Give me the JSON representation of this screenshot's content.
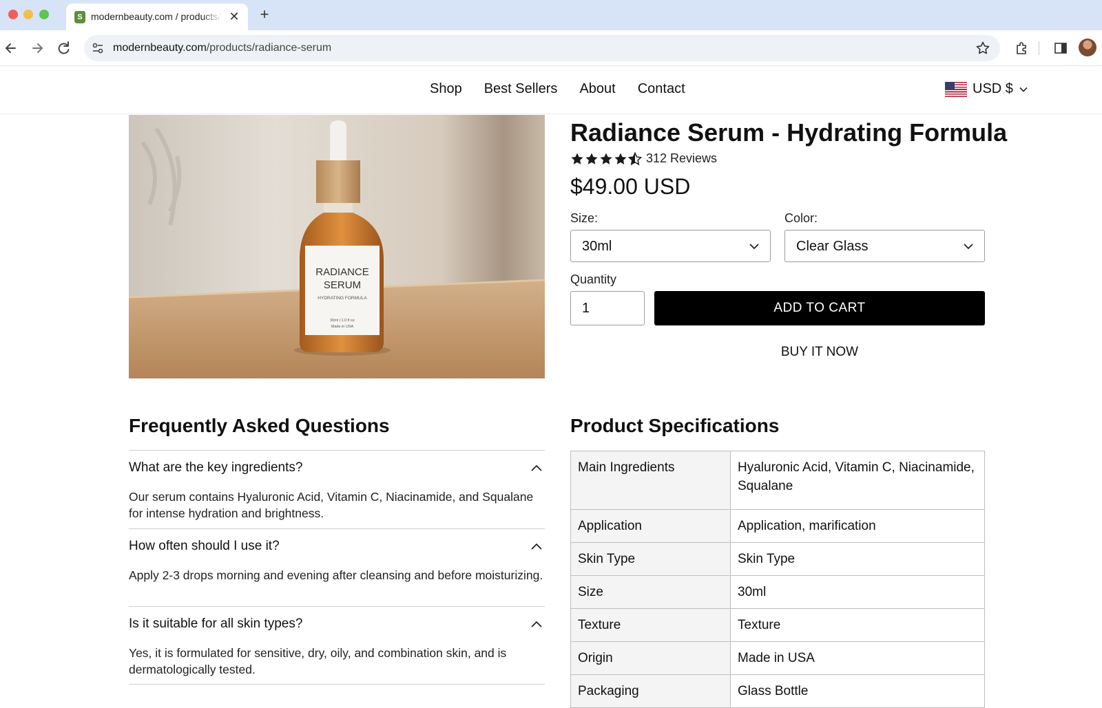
{
  "browser": {
    "tab_title": "modernbeauty.com / products/radiance-serum",
    "tab_close": "✕",
    "new_tab": "+",
    "url_host": "modernbeauty.com",
    "url_path": "/products/radiance-serum",
    "icons": [
      "back-icon",
      "forward-icon",
      "reload-icon",
      "site-settings-icon",
      "bookmark-star-icon",
      "extensions-icon",
      "side-panel-icon",
      "profile-avatar"
    ]
  },
  "nav": {
    "items": [
      "Shop",
      "Best Sellers",
      "About",
      "Contact"
    ],
    "currency": "USD $"
  },
  "product": {
    "title": "Radiance Serum - Hydrating Formula",
    "rating": 4.5,
    "reviews": "312 Reviews",
    "price": "$49.00 USD",
    "size_label": "Size:",
    "size_value": "30ml",
    "color_label": "Color:",
    "color_value": "Clear Glass",
    "quantity_label": "Quantity",
    "quantity_value": "1",
    "add_to_cart": "ADD TO CART",
    "buy_now": "BUY IT NOW",
    "image": {
      "label_line1": "RADIANCE",
      "label_line2": "SERUM",
      "label_line3": "HYDRATING FORMULA",
      "label_line4": "30ml | 1.0 fl oz",
      "label_line5": "Made in USA"
    }
  },
  "faq": {
    "heading": "Frequently Asked Questions",
    "items": [
      {
        "q": "What are the key ingredients?",
        "a": "Our serum contains Hyaluronic Acid, Vitamin C, Niacinamide, and Squalane for intense hydration and brightness."
      },
      {
        "q": "How often should I use it?",
        "a": "Apply 2-3 drops morning and evening after cleansing and before moisturizing."
      },
      {
        "q": "Is it suitable for all skin types?",
        "a": "Yes, it is formulated for sensitive, dry, oily, and combination skin, and is dermatologically tested."
      }
    ]
  },
  "specs": {
    "heading": "Product Specifications",
    "rows": [
      {
        "k": "Main Ingredients",
        "v": "Hyaluronic Acid, Vitamin C, Niacinamide, Squalane"
      },
      {
        "k": "Application",
        "v": "Application, marification"
      },
      {
        "k": "Skin Type",
        "v": "Skin Type"
      },
      {
        "k": "Size",
        "v": "30ml"
      },
      {
        "k": "Texture",
        "v": "Texture"
      },
      {
        "k": "Origin",
        "v": "Made in USA"
      },
      {
        "k": "Packaging",
        "v": "Glass Bottle"
      }
    ]
  },
  "colors": {
    "tab_strip": "#d7e3f7",
    "button_bg": "#000000",
    "star": "#1a1a1a"
  }
}
